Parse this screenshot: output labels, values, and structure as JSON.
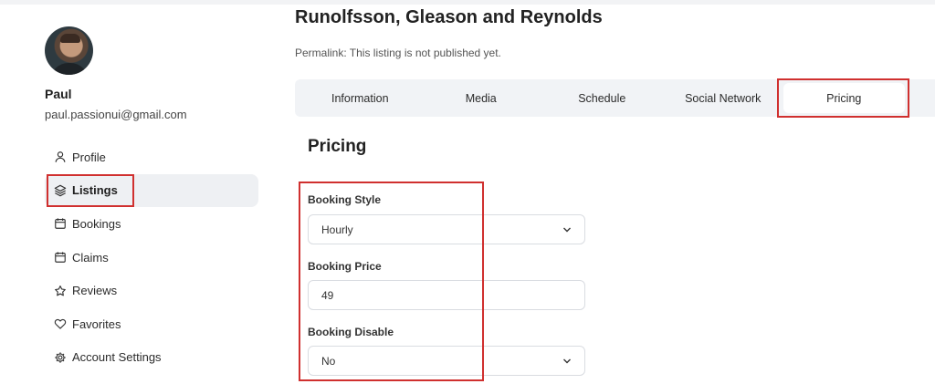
{
  "user": {
    "name": "Paul",
    "email": "paul.passionui@gmail.com"
  },
  "sidebar": {
    "items": [
      {
        "label": "Profile",
        "icon": "user-icon"
      },
      {
        "label": "Listings",
        "icon": "layers-icon",
        "active": true
      },
      {
        "label": "Bookings",
        "icon": "calendar-icon"
      },
      {
        "label": "Claims",
        "icon": "calendar-icon"
      },
      {
        "label": "Reviews",
        "icon": "star-icon"
      },
      {
        "label": "Favorites",
        "icon": "heart-icon"
      },
      {
        "label": "Account Settings",
        "icon": "gear-icon"
      }
    ]
  },
  "listing": {
    "title": "Runolfsson, Gleason and Reynolds",
    "permalink": "Permalink: This listing is not published yet."
  },
  "tabs": [
    {
      "label": "Information"
    },
    {
      "label": "Media"
    },
    {
      "label": "Schedule"
    },
    {
      "label": "Social Network"
    },
    {
      "label": "Pricing",
      "active": true
    }
  ],
  "pricing": {
    "section_title": "Pricing",
    "booking_style": {
      "label": "Booking Style",
      "value": "Hourly"
    },
    "booking_price": {
      "label": "Booking Price",
      "value": "49"
    },
    "booking_disable": {
      "label": "Booking Disable",
      "value": "No"
    }
  },
  "colors": {
    "highlight": "#d0302f",
    "tab_bar_bg": "#f1f3f6",
    "active_nav_bg": "#eef0f3"
  }
}
